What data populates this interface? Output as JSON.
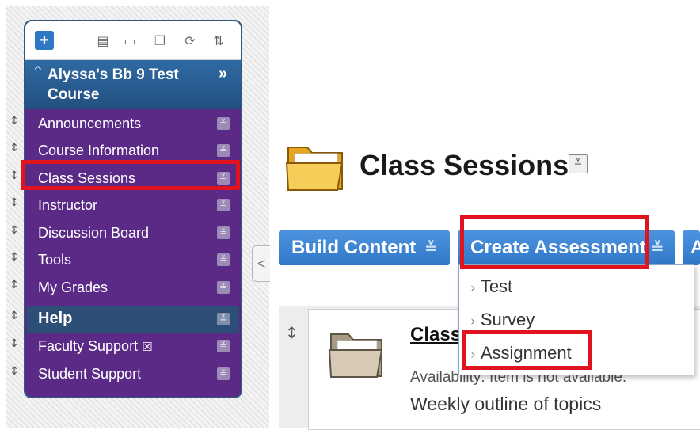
{
  "course_menu": {
    "add_symbol": "+",
    "toolbar_icons": [
      "list-view-icon",
      "folder-view-icon",
      "window-icon",
      "refresh-icon",
      "sort-icon"
    ],
    "toolbar_glyphs": [
      "▤",
      "▭",
      "❐",
      "⟳",
      "⇅"
    ],
    "collapse_glyph": "≈",
    "course_title": "Alyssa's Bb 9 Test Course",
    "expand_glyph": "»",
    "drag_glyph": "↕",
    "chevron_glyph": "≚",
    "items": [
      {
        "label": "Announcements",
        "type": "link"
      },
      {
        "label": "Course Information",
        "type": "link"
      },
      {
        "label": "Class Sessions",
        "type": "link",
        "highlighted": true
      },
      {
        "label": "Instructor",
        "type": "link"
      },
      {
        "label": "Discussion Board",
        "type": "link"
      },
      {
        "label": "Tools",
        "type": "link"
      },
      {
        "label": "My Grades",
        "type": "link"
      },
      {
        "label": "Help",
        "type": "header"
      },
      {
        "label": "Faculty Support",
        "type": "link",
        "badge": "☒"
      },
      {
        "label": "Student Support",
        "type": "link"
      }
    ],
    "collapse_tab_glyph": "<"
  },
  "page": {
    "title": "Class Sessions",
    "title_chevron": "≚"
  },
  "action_bar": {
    "build_content": "Build Content",
    "create_assessment": "Create Assessment",
    "third_partial": "A",
    "chevron": "≚"
  },
  "assessment_menu": {
    "arrow": "›",
    "items": [
      "Test",
      "Survey",
      "Assignment"
    ]
  },
  "content_item": {
    "drag": "↕",
    "title": "Class",
    "availability": "Availability:  Item is not available.",
    "description": "Weekly outline of topics"
  },
  "colors": {
    "menu_bg": "#5a2a86",
    "menu_header_bg": "#2d4e77",
    "button_blue": "#2f78c8",
    "callout_red": "#e0141e"
  }
}
